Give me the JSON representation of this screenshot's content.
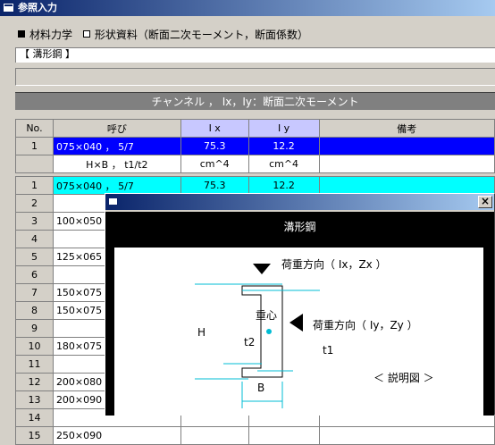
{
  "window": {
    "title": "参照入力"
  },
  "menu": {
    "option1": "材料力学",
    "option2": "形状資料（断面二次モーメント，断面係数）"
  },
  "category_field": {
    "value": "【 溝形鋼 】"
  },
  "table_header_bar": "チャンネル ， Ix，Iy：断面二次モーメント",
  "columns": {
    "no": "No.",
    "name": "呼び",
    "ix": "I x",
    "iy": "I y",
    "note": "備考"
  },
  "selected_row": {
    "no": "1",
    "name": "075×040 ， 5/7",
    "ix": "75.3",
    "iy": "12.2",
    "note": ""
  },
  "unit_row": {
    "no": "",
    "name": "H×B ， t1/t2",
    "ix": "cm^4",
    "iy": "cm^4",
    "note": ""
  },
  "rows": [
    {
      "no": "1",
      "name": "075×040 ， 5/7",
      "ix": "75.3",
      "iy": "12.2"
    },
    {
      "no": "2",
      "name": "",
      "ix": "",
      "iy": ""
    },
    {
      "no": "3",
      "name": "100×050",
      "ix": "",
      "iy": ""
    },
    {
      "no": "4",
      "name": "",
      "ix": "",
      "iy": ""
    },
    {
      "no": "5",
      "name": "125×065",
      "ix": "",
      "iy": ""
    },
    {
      "no": "6",
      "name": "",
      "ix": "",
      "iy": ""
    },
    {
      "no": "7",
      "name": "150×075",
      "ix": "",
      "iy": ""
    },
    {
      "no": "8",
      "name": "150×075",
      "ix": "",
      "iy": ""
    },
    {
      "no": "9",
      "name": "",
      "ix": "",
      "iy": ""
    },
    {
      "no": "10",
      "name": "180×075",
      "ix": "",
      "iy": ""
    },
    {
      "no": "11",
      "name": "",
      "ix": "",
      "iy": ""
    },
    {
      "no": "12",
      "name": "200×080",
      "ix": "",
      "iy": ""
    },
    {
      "no": "13",
      "name": "200×090",
      "ix": "",
      "iy": ""
    },
    {
      "no": "14",
      "name": "",
      "ix": "",
      "iy": ""
    },
    {
      "no": "15",
      "name": "250×090",
      "ix": "",
      "iy": ""
    }
  ],
  "popup": {
    "close": "×",
    "title": "溝形鋼",
    "load_x": "荷重方向（ Ix，Zx ）",
    "load_y": "荷重方向（ Iy，Zy ）",
    "centroid": "重心",
    "H": "H",
    "B": "B",
    "t1": "t1",
    "t2": "t2",
    "caption": "＜ 説明図 ＞"
  }
}
